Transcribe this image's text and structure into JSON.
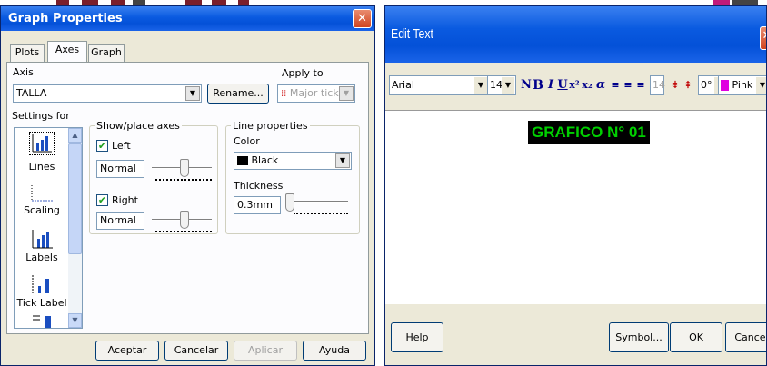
{
  "graph_properties": {
    "title": "Graph Properties",
    "close_glyph": "✕",
    "tabs": [
      {
        "label": "Plots",
        "active": false
      },
      {
        "label": "Axes",
        "active": true
      },
      {
        "label": "Graph",
        "active": false
      }
    ],
    "axis_label": "Axis",
    "axis_value": "TALLA",
    "rename_label": "Rename...",
    "apply_to_label": "Apply to",
    "apply_to_value": "Major ticks",
    "settings_for_label": "Settings for",
    "settings_items": [
      "Lines",
      "Scaling",
      "Labels",
      "Tick Label"
    ],
    "selected_setting": "Lines",
    "show_place_axes": {
      "legend": "Show/place axes",
      "left_label": "Left",
      "left_checked": true,
      "left_value": "Normal",
      "right_label": "Right",
      "right_checked": true,
      "right_value": "Normal"
    },
    "line_properties": {
      "legend": "Line properties",
      "color_label": "Color",
      "color_value": "Black",
      "color_swatch": "#000000",
      "thickness_label": "Thickness",
      "thickness_value": "0.3mm"
    },
    "buttons": {
      "ok": "Aceptar",
      "cancel": "Cancelar",
      "apply": "Aplicar",
      "help": "Ayuda"
    }
  },
  "edit_text": {
    "title": "Edit Text",
    "toolbar": {
      "font": "Arial",
      "size": "14",
      "size_disabled": "14",
      "rotation": "0°",
      "color_name": "Pink",
      "color_swatch": "#e000e0",
      "normal_label": "N",
      "bold_label": "B",
      "italic_label": "I",
      "underline_label": "U",
      "super_label": "x²",
      "sub_label": "x₂",
      "greek_label": "α"
    },
    "content_text": "GRAFICO N° 01",
    "content_fg": "#00d000",
    "content_bg": "#000000",
    "buttons": {
      "help": "Help",
      "symbol": "Symbol...",
      "ok": "OK",
      "cancel": "Cancel"
    }
  }
}
